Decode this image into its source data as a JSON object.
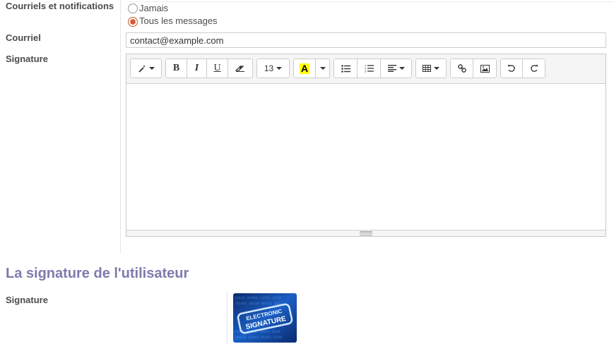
{
  "notifications": {
    "label": "Courriels et notifications",
    "options": [
      {
        "label": "Jamais",
        "checked": false
      },
      {
        "label": "Tous les messages",
        "checked": true
      }
    ]
  },
  "email": {
    "label": "Courriel",
    "value": "contact@example.com"
  },
  "signature": {
    "label": "Signature",
    "toolbar": {
      "font_size": "13",
      "bold": "B",
      "italic": "I",
      "underline": "U",
      "highlight": "A",
      "highlight_color": "#ffff00"
    },
    "content": ""
  },
  "user_signature": {
    "title": "La signature de l'utilisateur",
    "label": "Signature",
    "image_text_top": "ELECTRONIC",
    "image_text_bottom": "SIGNATURE"
  },
  "colors": {
    "section_title": "#7c7bad",
    "radio_checked": "#d25a2e"
  }
}
